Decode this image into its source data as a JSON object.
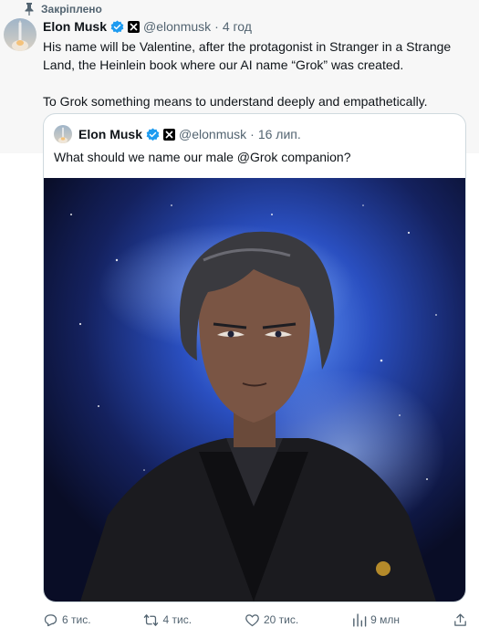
{
  "pinned": {
    "label": "Закріплено",
    "icon": "pin-icon"
  },
  "tweet": {
    "author_name": "Elon Musk",
    "handle": "@elonmusk",
    "separator": "·",
    "time": "4 год",
    "paragraphs": [
      "His name will be Valentine, after the protagonist in Stranger in a Strange Land, the Heinlein book where our AI name “Grok” was created.",
      "To Grok something means to understand deeply and empathetically."
    ]
  },
  "quote": {
    "author_name": "Elon Musk",
    "handle": "@elonmusk",
    "separator": "·",
    "time": "16 лип.",
    "text": "What should we name our male @Grok companion?",
    "media_icon": "anime-character-image"
  },
  "actions": {
    "replies": "6 тис.",
    "reposts": "4 тис.",
    "likes": "20 тис.",
    "views": "9 млн"
  },
  "colors": {
    "text": "#0f1419",
    "secondary": "#536471",
    "verified": "#1d9bf0",
    "border": "#cfd9de",
    "pinned_bg": "#f7f7f7"
  }
}
